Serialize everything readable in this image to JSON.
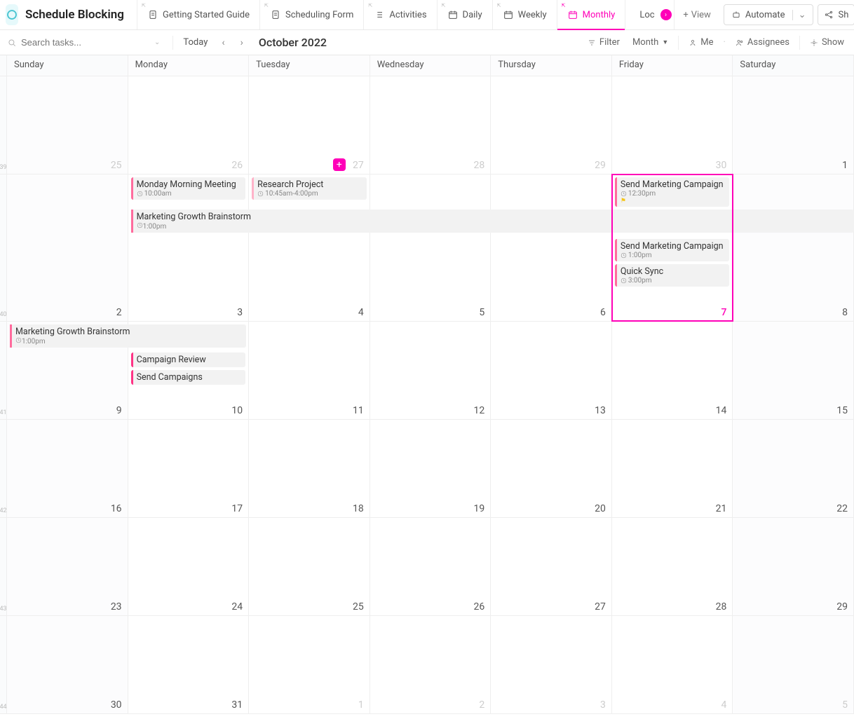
{
  "app": {
    "title": "Schedule Blocking"
  },
  "tabs": [
    {
      "label": "Getting Started Guide",
      "icon": "doc"
    },
    {
      "label": "Scheduling Form",
      "icon": "doc"
    },
    {
      "label": "Activities",
      "icon": "list"
    },
    {
      "label": "Daily",
      "icon": "cal"
    },
    {
      "label": "Weekly",
      "icon": "cal"
    },
    {
      "label": "Monthly",
      "icon": "cal",
      "active": true
    },
    {
      "label": "Loc",
      "icon": "pin",
      "truncated": true
    }
  ],
  "view_button": "View",
  "automate_button": "Automate",
  "share_button": "Sh",
  "toolbar": {
    "search_placeholder": "Search tasks...",
    "today": "Today",
    "current_month": "October 2022",
    "filter": "Filter",
    "period": "Month",
    "me": "Me",
    "assignees": "Assignees",
    "show": "Show"
  },
  "days": [
    "Sunday",
    "Monday",
    "Tuesday",
    "Wednesday",
    "Thursday",
    "Friday",
    "Saturday"
  ],
  "week_stubs": [
    "39",
    "40",
    "41",
    "42",
    "43",
    "44"
  ],
  "weeks": [
    {
      "stub": "39",
      "days": [
        {
          "num": "25",
          "out": true,
          "weekend": true
        },
        {
          "num": "26",
          "out": true,
          "add": false
        },
        {
          "num": "27",
          "out": true,
          "add": true
        },
        {
          "num": "28",
          "out": true
        },
        {
          "num": "29",
          "out": true
        },
        {
          "num": "30",
          "out": true
        },
        {
          "num": "1",
          "weekend": true
        }
      ]
    },
    {
      "stub": "40",
      "days": [
        {
          "num": "2",
          "weekend": true
        },
        {
          "num": "3"
        },
        {
          "num": "4"
        },
        {
          "num": "5"
        },
        {
          "num": "6"
        },
        {
          "num": "7",
          "today": true
        },
        {
          "num": "8",
          "weekend": true
        }
      ]
    },
    {
      "stub": "41",
      "days": [
        {
          "num": "9",
          "weekend": true
        },
        {
          "num": "10"
        },
        {
          "num": "11"
        },
        {
          "num": "12"
        },
        {
          "num": "13"
        },
        {
          "num": "14"
        },
        {
          "num": "15",
          "weekend": true
        }
      ]
    },
    {
      "stub": "42",
      "days": [
        {
          "num": "16",
          "weekend": true
        },
        {
          "num": "17"
        },
        {
          "num": "18"
        },
        {
          "num": "19"
        },
        {
          "num": "20"
        },
        {
          "num": "21"
        },
        {
          "num": "22",
          "weekend": true
        }
      ]
    },
    {
      "stub": "43",
      "days": [
        {
          "num": "23",
          "weekend": true
        },
        {
          "num": "24"
        },
        {
          "num": "25"
        },
        {
          "num": "26"
        },
        {
          "num": "27"
        },
        {
          "num": "28"
        },
        {
          "num": "29",
          "weekend": true
        }
      ]
    },
    {
      "stub": "44",
      "days": [
        {
          "num": "30",
          "weekend": true
        },
        {
          "num": "31"
        },
        {
          "num": "1",
          "out": true
        },
        {
          "num": "2",
          "out": true
        },
        {
          "num": "3",
          "out": true
        },
        {
          "num": "4",
          "out": true
        },
        {
          "num": "5",
          "out": true,
          "weekend": true
        }
      ]
    }
  ],
  "events": {
    "w1_mon_a": {
      "name": "Monday Morning Meeting",
      "time": "10:00am"
    },
    "w1_tue_a": {
      "name": "Research Project",
      "time": "10:45am-4:00pm"
    },
    "w1_span": {
      "name": "Marketing Growth Brainstorm",
      "time": "1:00pm"
    },
    "w1_fri_a": {
      "name": "Send Marketing Campaign",
      "time": "12:30pm",
      "flag": true
    },
    "w1_fri_b": {
      "name": "Send Marketing Campaign",
      "time": "1:00pm"
    },
    "w1_fri_c": {
      "name": "Quick Sync",
      "time": "3:00pm"
    },
    "w2_span": {
      "name": "Marketing Growth Brainstorm",
      "time": "1:00pm"
    },
    "w2_mon_a": {
      "name": "Campaign Review"
    },
    "w2_mon_b": {
      "name": "Send Campaigns"
    }
  }
}
